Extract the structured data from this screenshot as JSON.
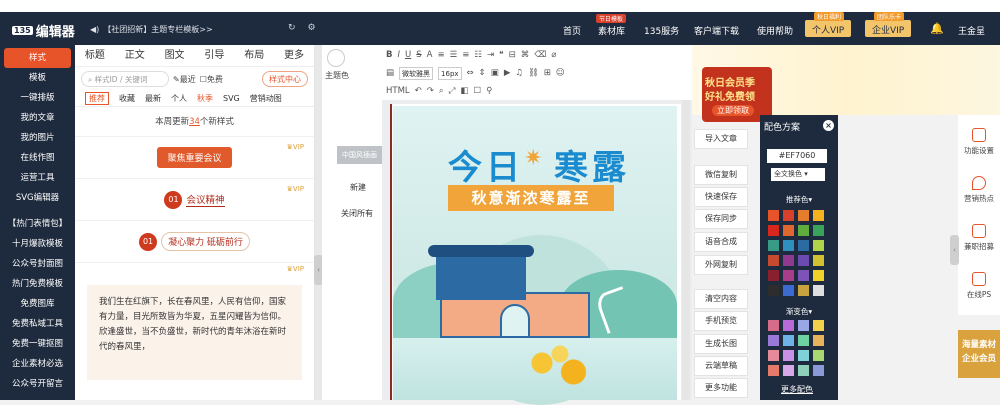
{
  "app": {
    "logo_badge": "135",
    "logo_text": "编辑器",
    "notice": "【社团招新】主题专栏模板>>",
    "notice_icon": "speaker-icon"
  },
  "nav": {
    "items": [
      {
        "label": "首页",
        "tag": ""
      },
      {
        "label": "素材库",
        "tag": "节日模板"
      },
      {
        "label": "135服务",
        "tag": ""
      },
      {
        "label": "客户端下载",
        "tag": ""
      },
      {
        "label": "使用帮助",
        "tag": ""
      }
    ],
    "vip_personal": {
      "label": "个人VIP",
      "tag": "秋日福利"
    },
    "vip_enterprise": {
      "label": "企业VIP",
      "tag": "团队乐卡"
    },
    "user": "王金呈"
  },
  "sidebar": {
    "items": [
      "样式",
      "模板",
      "一键排版",
      "我的文章",
      "我的图片",
      "在线作图",
      "运营工具",
      "SVG编辑器"
    ],
    "items2": [
      "【热门表情包】",
      "十月爆款模板",
      "公众号封面图",
      "热门免费模板",
      "免费图库",
      "免费私域工具",
      "免费一键抠图",
      "企业素材必选",
      "公众号开留言"
    ]
  },
  "template_panel": {
    "tabs": [
      "标题",
      "正文",
      "图文",
      "引导",
      "布局",
      "更多"
    ],
    "search_placeholder": "样式ID / 关键词",
    "recent": "最近",
    "free": "免费",
    "style_center": "样式中心",
    "subtabs": [
      "推荐",
      "收藏",
      "最新",
      "个人",
      "秋季",
      "SVG",
      "营销动图"
    ],
    "update_prefix": "本周更新",
    "update_count": "34",
    "update_suffix": "个新样式",
    "vip": "VIP",
    "card1": "聚焦重要会议",
    "card2_num": "01",
    "card2": "会议精神",
    "card3_num": "01",
    "card3": "凝心聚力 砥砺前行",
    "poem": "我们生在红旗下，长在春风里，人民有信仰，国家有力量，目光所致皆为华夏，五星闪耀皆为信仰。 欣逢盛世，当不负盛世，新时代的青年沐浴在新时代的春风里，"
  },
  "theme": {
    "label": "主题色",
    "cn_style": "中国风插画",
    "new": "新建",
    "close_all": "关闭所有"
  },
  "toolbar": {
    "font": "微软雅黑",
    "size": "16px"
  },
  "poster": {
    "title": "今日",
    "title2": "寒露",
    "subtitle": "秋意渐浓寒露至"
  },
  "actions": [
    "导入文章",
    "微信复制",
    "快速保存",
    "保存同步",
    "语音合成",
    "外网复制",
    "清空内容",
    "手机预览",
    "生成长图",
    "云端草稿",
    "更多功能"
  ],
  "color_panel": {
    "title": "配色方案",
    "hex": "#EF7060",
    "select": "全文换色",
    "recommend": "推荐色",
    "gradient": "渐变色",
    "more": "更多配色",
    "swatches": [
      "#e8542a",
      "#d9402b",
      "#e57c2b",
      "#f3b21e",
      "#d7261e",
      "#e0662f",
      "#5fae3d",
      "#3aa35b",
      "#3a9a88",
      "#2f8fbf",
      "#2c6aa3",
      "#b2d44a",
      "#c7492f",
      "#8f3a8f",
      "#6b4bb0",
      "#d1c02f",
      "#8a1f2e",
      "#aa3d8a",
      "#7c54b8",
      "#f2d12a",
      "#2d2d2d",
      "#3c6ad1",
      "#c8a23f",
      "#dedede"
    ],
    "gradients": [
      "#d66b8a",
      "#b86bd6",
      "#9aa7e6",
      "#f3d14a",
      "#9a78d8",
      "#6fb2e6",
      "#6fd0a2",
      "#e6b25a",
      "#e68a9a",
      "#c890e6",
      "#7fd0d8",
      "#a8d86f",
      "#e67a6a",
      "#d8a7e6",
      "#8fd0b8",
      "#8a9ad8"
    ]
  },
  "promo": {
    "line1": "秋日会员季",
    "line2": "好礼免费领",
    "cta": "立即领取"
  },
  "right_tools": [
    "功能设置",
    "营销热点",
    "兼职招募",
    "在线PS"
  ],
  "member": {
    "line1": "海量素材",
    "line2": "企业会员"
  }
}
